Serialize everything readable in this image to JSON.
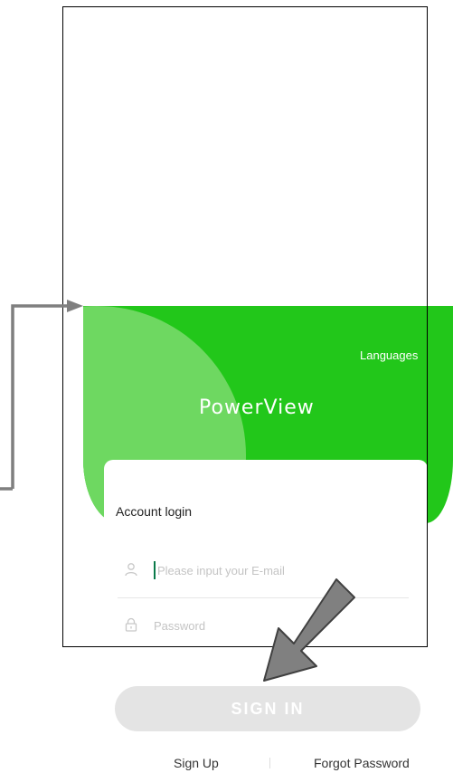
{
  "header": {
    "languages_label": "Languages",
    "logo_text": "PowerView"
  },
  "login": {
    "title": "Account login",
    "email_placeholder": "Please input your E-mail",
    "password_placeholder": "Password",
    "sign_in_label": "SIGN IN"
  },
  "footer": {
    "sign_up_label": "Sign Up",
    "forgot_password_label": "Forgot Password"
  },
  "icons": {
    "email": "user-icon",
    "password": "lock-icon"
  },
  "colors": {
    "brand_green": "#22c71a",
    "brand_green_light": "#6ed861",
    "button_disabled": "#e4e4e4",
    "annotation_arrow": "#7f7f7f"
  }
}
